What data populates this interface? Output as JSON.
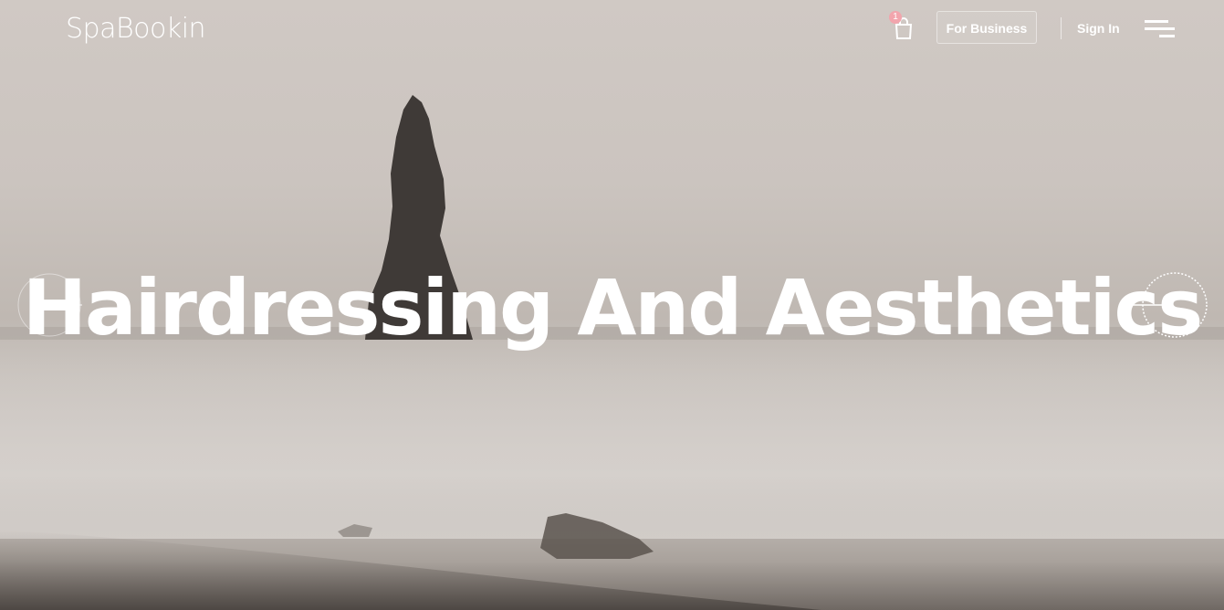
{
  "brand": {
    "logo_text": "SpaBookin"
  },
  "header": {
    "cart_count": "1",
    "for_business_label": "For Business",
    "sign_in_label": "Sign In"
  },
  "hero": {
    "headline": "Hairdressing And Aesthetics"
  },
  "icons": {
    "cart": "shopping-bag-icon",
    "menu": "hamburger-menu-icon",
    "prev": "arrow-left-icon",
    "next": "arrow-right-icon"
  },
  "colors": {
    "badge": "#f2a5ad",
    "text": "#ffffff"
  }
}
